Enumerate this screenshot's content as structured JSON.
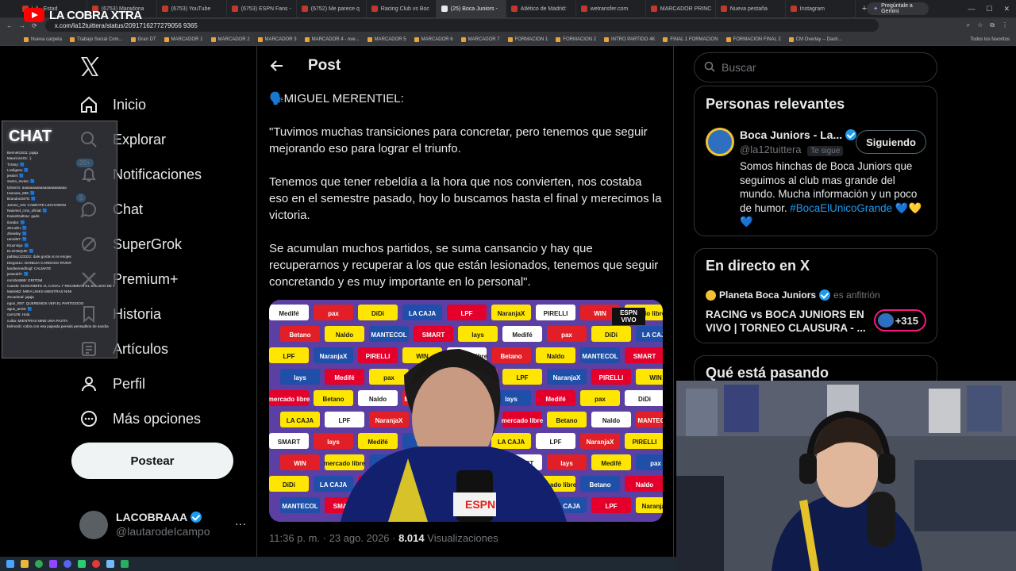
{
  "overlay": {
    "channel_name": "LA COBRA XTRA",
    "chat_title": "CHAT"
  },
  "browser": {
    "tabs": [
      {
        "label": "i, li - Estad",
        "active": false
      },
      {
        "label": "(6753) Maradona",
        "active": false
      },
      {
        "label": "(6753) YouTube",
        "active": false
      },
      {
        "label": "(6753) ESPN Fans -",
        "active": false
      },
      {
        "label": "(6752) Me parece q",
        "active": false
      },
      {
        "label": "Racing Club vs Boc",
        "active": false
      },
      {
        "label": "(25) Boca Juniors -",
        "active": true
      },
      {
        "label": "Atlético de Madrid:",
        "active": false
      },
      {
        "label": "wetransfer.com",
        "active": false
      },
      {
        "label": "MARCADOR PRINC",
        "active": false
      },
      {
        "label": "Nueva pestaña",
        "active": false
      },
      {
        "label": "Instagram",
        "active": false
      }
    ],
    "new_tab_symbol": "+",
    "gemini_button": "Pregúntale a Gemini",
    "url": "x.com/la12tuittera/status/2091716277279056 9365",
    "bookmarks": [
      "Nueva carpeta",
      "Trabajo Social Com...",
      "Gran DT",
      "MARCADOR 1",
      "MARCADOR 2",
      "MARCADOR 3",
      "MARCADOR 4 - ove...",
      "MARCADOR 5",
      "MARCADOR 6",
      "MARCADOR 7",
      "FORMACION 1",
      "FORMACION 2",
      "INTRO PARTIDO 4K",
      "FINAL 1 FORMACION",
      "FORMACION FINAL 2",
      "CM Overlay -- Dash..."
    ],
    "all_bookmarks": "Todos los favoritos"
  },
  "nav": {
    "items": [
      {
        "label": "Inicio",
        "icon": "home-icon"
      },
      {
        "label": "Explorar",
        "icon": "search-icon"
      },
      {
        "label": "Notificaciones",
        "icon": "bell-icon",
        "badge": "20+"
      },
      {
        "label": "Chat",
        "icon": "chat-icon",
        "badge": "5"
      },
      {
        "label": "SuperGrok",
        "icon": "grok-icon"
      },
      {
        "label": "Premium+",
        "icon": "x-premium-icon"
      },
      {
        "label": "Historia",
        "icon": "bookmark-icon"
      },
      {
        "label": "Artículos",
        "icon": "articles-icon"
      },
      {
        "label": "Perfil",
        "icon": "person-icon"
      },
      {
        "label": "Más opciones",
        "icon": "more-circle-icon"
      }
    ],
    "post_button": "Postear"
  },
  "profile": {
    "name": "LACOBRAAA",
    "handle": "@lautarodeIcampo",
    "more": "···"
  },
  "post": {
    "header_title": "Post",
    "paragraphs": [
      "🗣️MIGUEL MERENTIEL:",
      "\"Tuvimos muchas transiciones para concretar, pero tenemos que seguir mejorando eso para lograr el triunfo.",
      "Tenemos que tener rebeldía a la hora que nos convierten, nos costaba eso en el semestre pasado, hoy lo buscamos hasta el final y merecimos la victoria.",
      "Se acumulan muchos partidos, se suma cansancio y hay que recuperarnos y recuperar a los que están lesionados, tenemos que seguir concretando y es muy importante en lo personal\"."
    ],
    "time": "11:36 p. m. · 23 ago. 2026 · ",
    "views_count": "8.014",
    "views_label": " Visualizaciones",
    "media_sponsors": [
      "Medifé",
      "pax",
      "DiDi",
      "LA CAJA",
      "LPF",
      "NaranjaX",
      "PIRELLI",
      "WIN",
      "mercado libre",
      "Betano",
      "Naldo",
      "MANTECOL",
      "SMART",
      "lays"
    ],
    "media_badge": "ESPN VIVO",
    "media_mic_label": "ESPN"
  },
  "right": {
    "search_placeholder": "Buscar",
    "relevant": {
      "title": "Personas relevantes",
      "name": "Boca Juniors - La...",
      "handle": "@la12tuittera",
      "follows_you": "Te sigue",
      "button": "Siguiendo",
      "bio": "Somos hinchas de Boca Juniors que seguimos al club mas grande del mundo. Mucha información y un poco de humor. ",
      "hashtag": "#BocaElUnicoGrande",
      "hearts": "💙💛 💙"
    },
    "live": {
      "title": "En directo en X",
      "host": "Planeta Boca Juniors",
      "host_role": "es anfitrión",
      "event": "RACING vs BOCA JUNIORS EN VIVO | TORNEO CLAUSURA - ...",
      "listeners": "+315"
    },
    "happening_title": "Qué está pasando"
  },
  "chat_messages": [
    "Bennett1611: jajaja",
    "Mauricio101: :)",
    "Tr3ssy: 🟦",
    "Lesligera: 🟦",
    "jessiel: 🟦",
    "Santo_Inviso: 🟦",
    "tyhanzo: aaaaaaaaaaaaaaaaaaaaaa",
    "Haroara_865: 🟦",
    "Brandon3476: 🟦",
    "James_Hst: CABRATE LECHONNN",
    "Naiomel_cmo_oficial: 🟦",
    "DanielGaltrac: gado",
    "Ilarabo: 🟦",
    "ZEmelin: 🟦",
    "Zkewley: 🟦",
    "ramol57: 🟦",
    "Kluoninja: 🟦",
    "ELOH6QUE: 🟦",
    "pabloip123321: dale gorda no te enojes",
    "Diego41c: DONEZA CARDOSO RIVER",
    "landtennedhogl: CALMATE",
    "jessedd7: 🟦",
    "mrrobot669: GRITOM",
    "CaneB: SUSCRIBITE AL CANAL Y RECIBIRAS EL SALUDO DE TUS CLUBES FAVORITOS!",
    "MarteB2: MIRA LINKS MIENTRAS NINI",
    "Zocadoral: jajaja",
    "ngoo_R87: QUEREMOS VER EL PARTIDOOO",
    "agus_arr32: 🟦",
    "cam106: Hola",
    "cuiba: MIENTRAS NINE UNA PAJITA",
    "belmonb: cobra con esa pajeada pensás pensaditos de sandía"
  ],
  "colors": {
    "background": "#000000",
    "text": "#e7e9ea",
    "muted": "#71767b",
    "border": "#2f3336",
    "accent": "#1d9bf0"
  }
}
